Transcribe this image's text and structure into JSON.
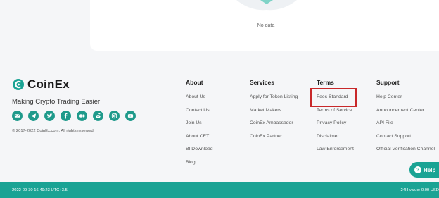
{
  "panel": {
    "empty_text": "No data"
  },
  "brand": {
    "name": "CoinEx",
    "tagline": "Making Crypto Trading Easier",
    "copyright": "© 2017-2022 CoinEx.com. All rights reserved.",
    "social_icons": [
      "email-icon",
      "telegram-icon",
      "twitter-icon",
      "facebook-icon",
      "medium-icon",
      "reddit-icon",
      "instagram-icon",
      "youtube-icon"
    ]
  },
  "columns": [
    {
      "key": "about",
      "title": "About",
      "links": [
        "About Us",
        "Contact Us",
        "Join Us",
        "About CET",
        "BI Download",
        "Blog"
      ]
    },
    {
      "key": "services",
      "title": "Services",
      "links": [
        "Apply for Token Listing",
        "Market Makers",
        "CoinEx Ambassador",
        "CoinEx Partner"
      ]
    },
    {
      "key": "terms",
      "title": "Terms",
      "links": [
        "Fees Standard",
        "Terms of Service",
        "Privacy Policy",
        "Disclaimer",
        "Law Enforcement"
      ]
    },
    {
      "key": "support",
      "title": "Support",
      "links": [
        "Help Center",
        "Announcement Center",
        "API File",
        "Contact Support",
        "Official Verification Channel"
      ]
    }
  ],
  "help": {
    "label": "Help"
  },
  "status": {
    "left": "2022-09-30  16:49:23  UTC+3.5",
    "right": "24H value: 0.00 USD"
  },
  "colors": {
    "accent": "#1aa394",
    "highlight": "#c8282a"
  }
}
